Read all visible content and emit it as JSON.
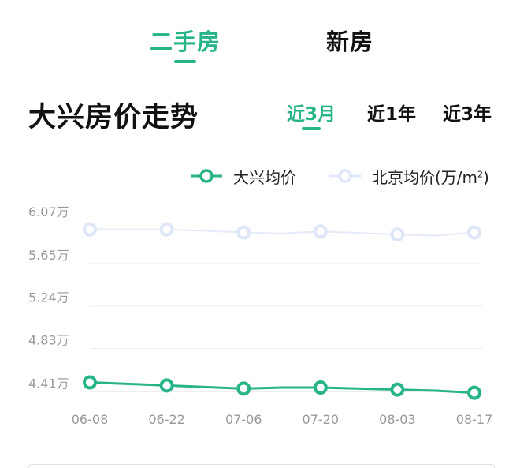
{
  "top_tabs": [
    {
      "label": "二手房",
      "active": true
    },
    {
      "label": "新房",
      "active": false
    }
  ],
  "section": {
    "title": "大兴房价走势"
  },
  "range_tabs": [
    {
      "label": "近3月",
      "active": true
    },
    {
      "label": "近1年",
      "active": false
    },
    {
      "label": "近3年",
      "active": false
    }
  ],
  "legend": {
    "series1": "大兴均价",
    "series2_prefix": "北京均价(万/m",
    "series2_sup": "2",
    "series2_suffix": ")"
  },
  "colors": {
    "accent": "#27b488",
    "beijing": "#dde7f8",
    "beijing_line": "#e4ebf7",
    "grid": "#eeeeee",
    "axis_text": "#999999"
  },
  "chart_data": {
    "type": "line",
    "categories": [
      "06-08",
      "06-22",
      "07-06",
      "07-20",
      "08-03",
      "08-17"
    ],
    "y_tick_labels": [
      "6.07万",
      "5.65万",
      "5.24万",
      "4.83万",
      "4.41万"
    ],
    "y_ticks": [
      6.07,
      5.65,
      5.24,
      4.83,
      4.41
    ],
    "ylim": [
      4.2,
      6.07
    ],
    "series": [
      {
        "name": "大兴均价",
        "x": [
          "06-08",
          "06-22",
          "07-06",
          "07-20",
          "08-03",
          "08-17"
        ],
        "values": [
          4.41,
          4.38,
          4.35,
          4.36,
          4.34,
          4.31
        ],
        "line_values": [
          4.41,
          4.38,
          4.35,
          4.36,
          4.36,
          4.34,
          4.33,
          4.31
        ],
        "line_x": [
          0,
          1,
          2,
          2.5,
          3,
          4,
          4.5,
          5
        ]
      },
      {
        "name": "北京均价",
        "x": [
          "06-08",
          "06-22",
          "07-06",
          "07-20",
          "08-03",
          "08-17"
        ],
        "values": [
          5.89,
          5.89,
          5.86,
          5.87,
          5.84,
          5.86
        ],
        "line_values": [
          5.89,
          5.89,
          5.86,
          5.85,
          5.87,
          5.84,
          5.83,
          5.86
        ],
        "line_x": [
          0,
          1,
          2,
          2.5,
          3,
          4,
          4.5,
          5
        ]
      }
    ],
    "grid": true,
    "legend_position": "top-right"
  }
}
